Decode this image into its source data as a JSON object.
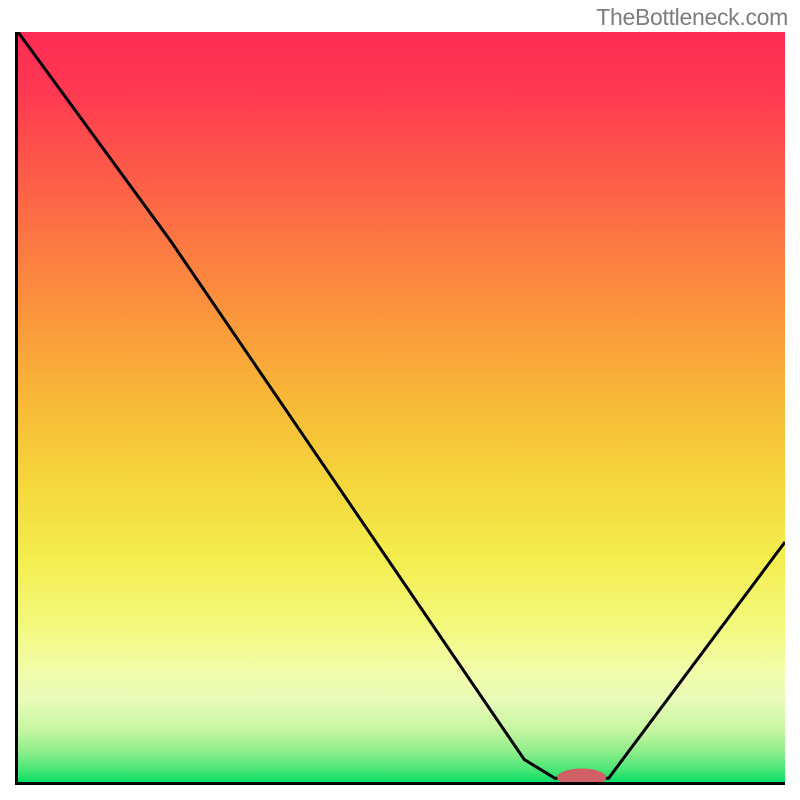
{
  "watermark": "TheBottleneck.com",
  "chart_data": {
    "type": "line",
    "title": "",
    "xlabel": "",
    "ylabel": "",
    "xlim": [
      0,
      100
    ],
    "ylim": [
      0,
      100
    ],
    "legend": false,
    "grid": false,
    "annotations": [],
    "curve_points": [
      {
        "x": 0,
        "y": 100
      },
      {
        "x": 20,
        "y": 72
      },
      {
        "x": 66,
        "y": 3
      },
      {
        "x": 70,
        "y": 0.5
      },
      {
        "x": 77,
        "y": 0.5
      },
      {
        "x": 100,
        "y": 32
      }
    ],
    "curve_description": "Asymmetric V-shaped black curve descending steeply from upper-left to a flat minimum near x≈70–77, then rising moderately to the right.",
    "marker": {
      "x_center": 73.5,
      "y": 0.6,
      "radius_x": 3.2,
      "radius_y": 1.2,
      "color": "#cf6066"
    },
    "background_gradient": {
      "orientation": "vertical",
      "stops": [
        {
          "pos": 0,
          "color": "#fe2b55"
        },
        {
          "pos": 0.5,
          "color": "#f7c838"
        },
        {
          "pos": 0.82,
          "color": "#f3fb8e"
        },
        {
          "pos": 1.0,
          "color": "#08df67"
        }
      ]
    }
  }
}
